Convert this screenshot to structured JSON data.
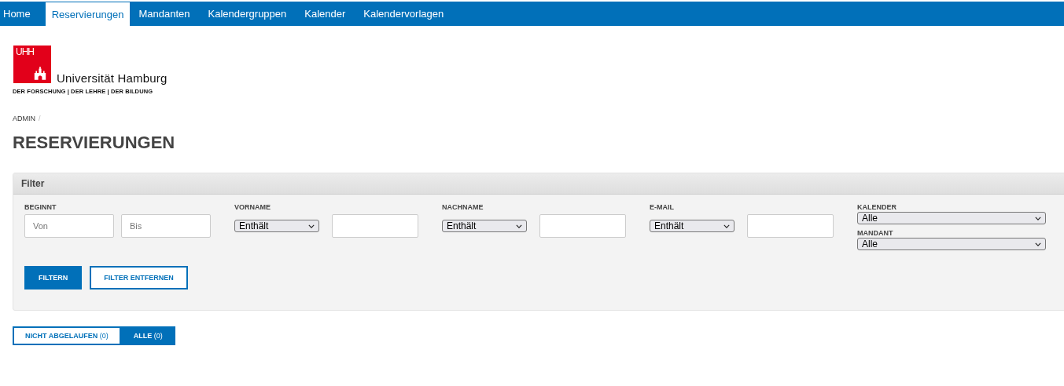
{
  "nav": [
    {
      "label": "Home",
      "selected": false
    },
    {
      "label": "Reservierungen",
      "selected": true
    },
    {
      "label": "Mandanten",
      "selected": false
    },
    {
      "label": "Kalendergruppen",
      "selected": false
    },
    {
      "label": "Kalender",
      "selected": false
    },
    {
      "label": "Kalendervorlagen",
      "selected": false
    }
  ],
  "logo": {
    "mark": "UHH",
    "name": "Universität Hamburg",
    "tagline": "DER FORSCHUNG | DER LEHRE | DER BILDUNG"
  },
  "breadcrumb": [
    {
      "label": "ADMIN",
      "separator": "/"
    }
  ],
  "title": "RESERVIERUNGEN",
  "filter": {
    "title": "Filter",
    "groups": [
      {
        "kind": "range",
        "label": "BEGINNT",
        "fields": [
          {
            "placeholder": "Von"
          },
          {
            "placeholder": "Bis"
          }
        ]
      },
      {
        "kind": "match",
        "label": "VORNAME",
        "operator": "Enthält"
      },
      {
        "kind": "match",
        "label": "NACHNAME",
        "operator": "Enthält"
      },
      {
        "kind": "match",
        "label": "E-MAIL",
        "operator": "Enthält"
      },
      {
        "kind": "selects",
        "selects": [
          {
            "label": "KALENDER",
            "value": "Alle"
          },
          {
            "label": "MANDANT",
            "value": "Alle"
          }
        ]
      }
    ],
    "buttons": [
      {
        "label": "FILTERN",
        "kind": "primary"
      },
      {
        "label": "FILTER ENTFERNEN",
        "kind": "outline"
      }
    ]
  },
  "tabs": [
    {
      "label": "**NICHT ABGELAUFEN** (0)",
      "selected": false
    },
    {
      "label": "**ALLE** (0)",
      "selected": true
    }
  ]
}
